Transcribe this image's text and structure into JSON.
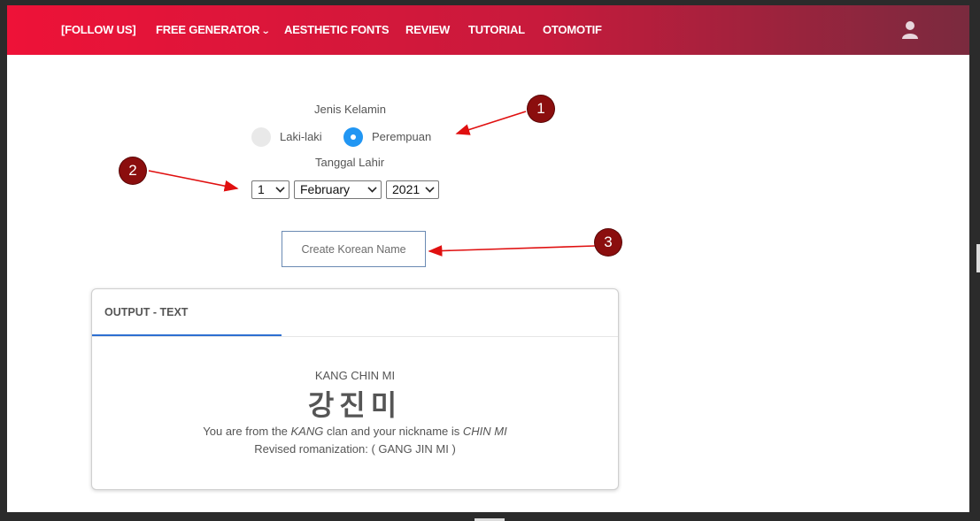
{
  "nav": {
    "items": [
      {
        "label": "[FOLLOW US]"
      },
      {
        "label": "FREE GENERATOR"
      },
      {
        "label": "AESTHETIC FONTS"
      },
      {
        "label": "REVIEW"
      },
      {
        "label": "TUTORIAL"
      },
      {
        "label": "OTOMOTIF"
      }
    ],
    "user_icon": "user-icon"
  },
  "form": {
    "gender_label": "Jenis Kelamin",
    "gender_options": [
      {
        "label": "Laki-laki",
        "selected": false
      },
      {
        "label": "Perempuan",
        "selected": true
      }
    ],
    "dob_label": "Tanggal Lahir",
    "day": "1",
    "month": "February",
    "year": "2021",
    "create_button": "Create Korean Name"
  },
  "output": {
    "tab_label": "OUTPUT - TEXT",
    "romanized_name": "KANG CHIN MI",
    "hangul": "강진미",
    "desc_prefix": "You are from the ",
    "clan": "KANG",
    "desc_middle": " clan and your nickname is ",
    "nickname": "CHIN MI",
    "revised": "Revised romanization: ( GANG JIN MI )"
  },
  "annotations": {
    "badges": [
      "1",
      "2",
      "3"
    ],
    "color": "#8b0e0e",
    "arrow_color": "#e01010"
  },
  "colors": {
    "nav_start": "#ee1238",
    "nav_end": "#7a2a3e",
    "radio_selected": "#2196f3",
    "tab_underline": "#2e6fd1"
  }
}
